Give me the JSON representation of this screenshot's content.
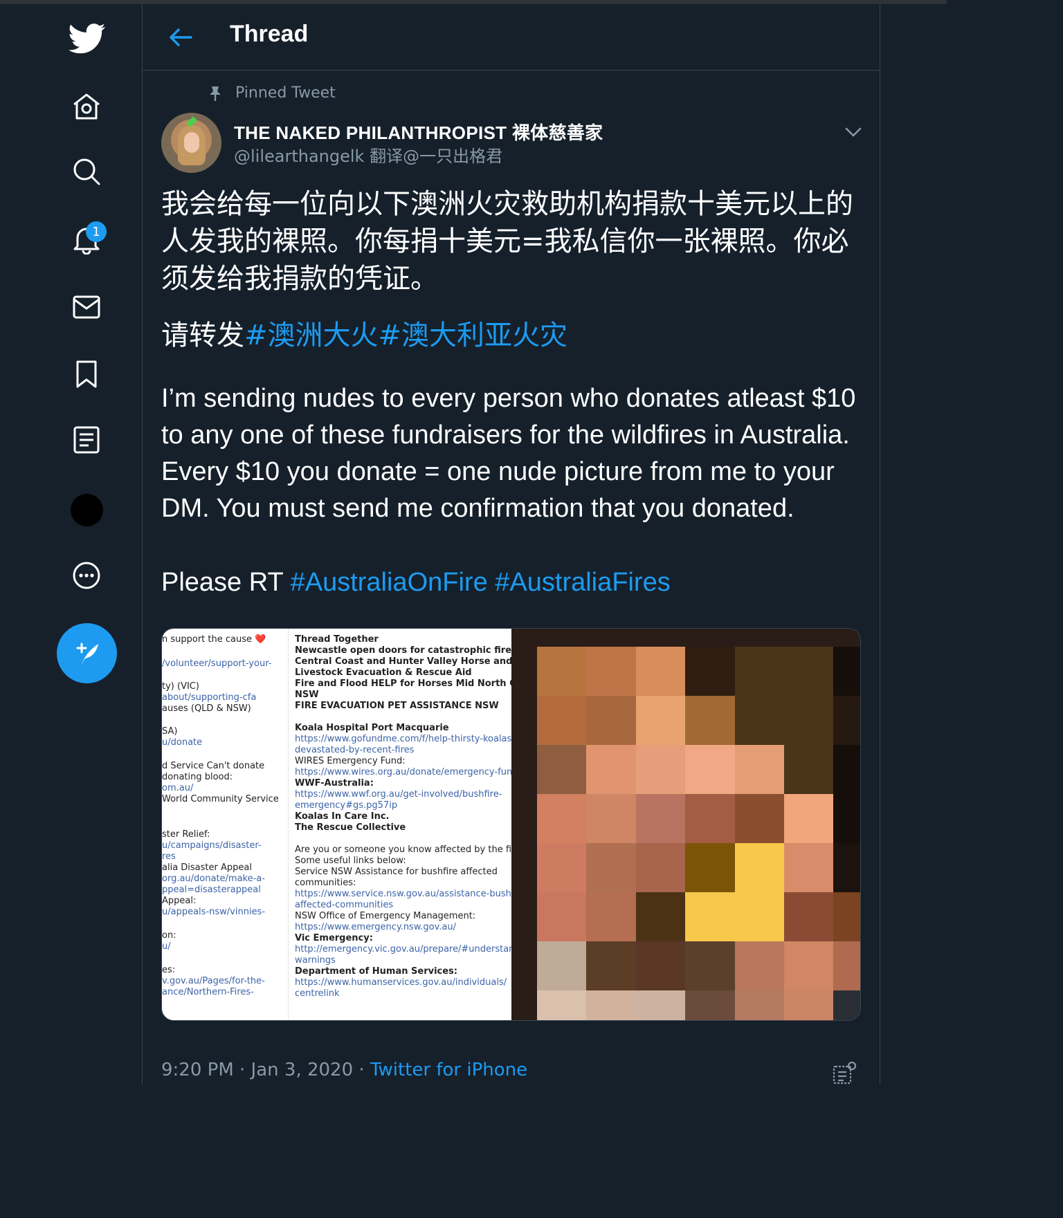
{
  "header": {
    "title": "Thread"
  },
  "nav": {
    "notification_count": "1",
    "items": [
      "twitter-logo",
      "home-icon",
      "explore-icon",
      "notifications-icon",
      "messages-icon",
      "bookmarks-icon",
      "lists-icon",
      "profile-avatar",
      "more-icon",
      "compose-tweet-icon"
    ]
  },
  "tweet": {
    "pinned_label": "Pinned Tweet",
    "author_name": "THE NAKED PHILANTHROPIST 裸体慈善家",
    "author_handle": "@lilearthangelk 翻译@一只出格君",
    "text_zh": "我会给每一位向以下澳洲火灾救助机构捐款十美元以上的人发我的裸照。你每捐十美元=我私信你一张裸照。你必须发给我捐款的凭证。",
    "text_zh_rt": "请转发",
    "hashtags_zh": [
      "#澳洲大火",
      "#澳大利亚火灾"
    ],
    "text_en": "I’m sending nudes to every person who donates atleast $10 to any one of these fundraisers for the wildfires in Australia. Every $10 you donate = one nude picture from me to your DM. You must send me confirmation that you donated.",
    "text_en_rt": "Please RT",
    "hashtags_en": [
      "#AustraliaOnFire",
      "#AustraliaFires"
    ],
    "timestamp": "9:20 PM · Jan 3, 2020 ·",
    "source": "Twitter for iPhone"
  },
  "media": {
    "left_column_lines": [
      {
        "t": "n support the cause ❤️",
        "s": "n"
      },
      {
        "t": "/volunteer/support-your-",
        "s": "link"
      },
      {
        "t": "ty) (VIC)",
        "s": "n"
      },
      {
        "t": "about/supporting-cfa",
        "s": "link"
      },
      {
        "t": "auses (QLD & NSW)",
        "s": "n"
      },
      {
        "t": "SA)",
        "s": "n"
      },
      {
        "t": "u/donate",
        "s": "link"
      },
      {
        "t": "d Service Can't donate",
        "s": "n"
      },
      {
        "t": "donating blood:",
        "s": "n"
      },
      {
        "t": "om.au/",
        "s": "link"
      },
      {
        "t": " World Community Service",
        "s": "n"
      },
      {
        "t": "ster Relief:",
        "s": "n"
      },
      {
        "t": "u/campaigns/disaster-",
        "s": "link"
      },
      {
        "t": "res",
        "s": "link"
      },
      {
        "t": "alia Disaster Appeal",
        "s": "n"
      },
      {
        "t": "org.au/donate/make-a-",
        "s": "link"
      },
      {
        "t": "ppeal=disasterappeal",
        "s": "link"
      },
      {
        "t": " Appeal:",
        "s": "n"
      },
      {
        "t": "u/appeals-nsw/vinnies-",
        "s": "link"
      },
      {
        "t": "on:",
        "s": "n"
      },
      {
        "t": "u/",
        "s": "link"
      },
      {
        "t": "es:",
        "s": "n"
      },
      {
        "t": "v.gov.au/Pages/for-the-",
        "s": "link"
      },
      {
        "t": "ance/Northern-Fires-",
        "s": "link"
      }
    ],
    "right_column_lines": [
      {
        "t": "Thread Together",
        "s": "b"
      },
      {
        "t": "Newcastle open doors for catastrophic fire risk",
        "s": "b"
      },
      {
        "t": "Central Coast and Hunter Valley Horse and",
        "s": "b"
      },
      {
        "t": "Livestock Evacuation & Rescue Aid",
        "s": "b"
      },
      {
        "t": "Fire and Flood HELP for Horses Mid North Coast",
        "s": "b"
      },
      {
        "t": "NSW",
        "s": "b"
      },
      {
        "t": "FIRE EVACUATION PET ASSISTANCE NSW",
        "s": "b"
      },
      {
        "t": "Koala Hospital Port Macquarie",
        "s": "b"
      },
      {
        "t": "https://www.gofundme.com/f/help-thirsty-koalas-",
        "s": "link"
      },
      {
        "t": "devastated-by-recent-fires",
        "s": "link"
      },
      {
        "t": "WIRES Emergency Fund:",
        "s": "n"
      },
      {
        "t": "https://www.wires.org.au/donate/emergency-fund",
        "s": "link"
      },
      {
        "t": "WWF-Australia:",
        "s": "b"
      },
      {
        "t": "https://www.wwf.org.au/get-involved/bushfire-",
        "s": "link"
      },
      {
        "t": "emergency#gs.pg57ip",
        "s": "link"
      },
      {
        "t": "Koalas In Care Inc.",
        "s": "b"
      },
      {
        "t": "The Rescue Collective",
        "s": "b"
      },
      {
        "t": "Are you or someone you know affected by the fires?",
        "s": "n"
      },
      {
        "t": "Some useful links below:",
        "s": "n"
      },
      {
        "t": "Service NSW Assistance for bushfire affected",
        "s": "n"
      },
      {
        "t": "communities:",
        "s": "n"
      },
      {
        "t": "https://www.service.nsw.gov.au/assistance-bushfire-",
        "s": "link"
      },
      {
        "t": "affected-communities",
        "s": "link"
      },
      {
        "t": "NSW Office of Emergency Management:",
        "s": "n"
      },
      {
        "t": "https://www.emergency.nsw.gov.au/",
        "s": "link"
      },
      {
        "t": "Vic Emergency:",
        "s": "b"
      },
      {
        "t": "http://emergency.vic.gov.au/prepare/#understanding-",
        "s": "link"
      },
      {
        "t": "warnings",
        "s": "link"
      },
      {
        "t": "Department of Human Services:",
        "s": "b"
      },
      {
        "t": "https://www.humanservices.gov.au/individuals/",
        "s": "link"
      },
      {
        "t": "centrelink",
        "s": "link"
      }
    ],
    "pixel_grid": [
      [
        "#b8743e",
        "#c07548",
        "#d98c5c",
        "#2e1d10",
        "#4a3519",
        "#4a3519",
        "#150e0a"
      ],
      [
        "#b36b3e",
        "#a7673c",
        "#e9a370",
        "#a16a34",
        "#4a3519",
        "#4a3519",
        "#25180f"
      ],
      [
        "#8f5d40",
        "#e29470",
        "#e69e7a",
        "#f1a884",
        "#e59d73",
        "#4a3519",
        "#150e0a"
      ],
      [
        "#d28060",
        "#cf8664",
        "#b87460",
        "#a35d42",
        "#8a4e2f",
        "#f2a67c",
        "#150e0a"
      ],
      [
        "#cd7c62",
        "#b06f50",
        "#a8654b",
        "#7c5408",
        "#f7c84b",
        "#d98c69",
        "#1c1311"
      ],
      [
        "#c9775f",
        "#b56e52",
        "#4b3215",
        "#f7c84b",
        "#f7c84b",
        "#8b4a34",
        "#7b4322"
      ],
      [
        "#c0ab98",
        "#5c3d26",
        "#5a3726",
        "#5a412e",
        "#b8775c",
        "#d18664",
        "#b06a4f"
      ],
      [
        "#d9c1ad",
        "#d2b29d",
        "#ccb2a0",
        "#6b4b3b",
        "#b57a62",
        "#cc8467",
        "#2a2f36"
      ]
    ]
  }
}
